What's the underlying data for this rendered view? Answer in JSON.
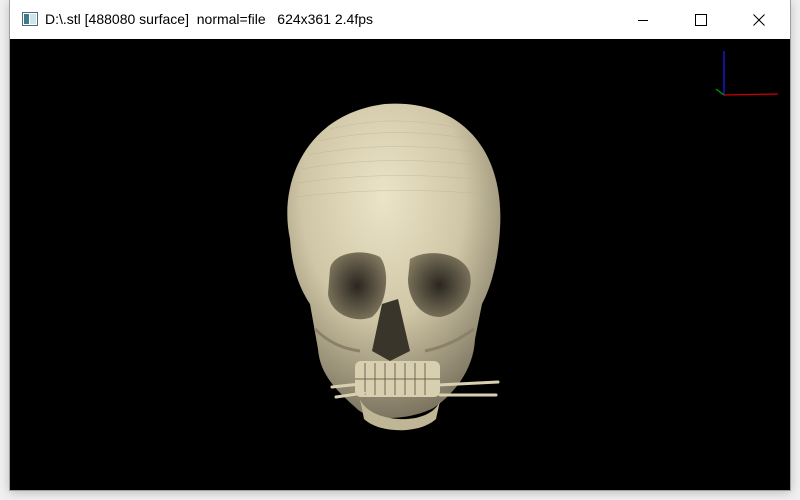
{
  "window": {
    "title": "D:\\.stl [488080 surface]  normal=file   624x361 2.4fps",
    "controls": {
      "minimize_icon": "minimize-icon",
      "maximize_icon": "maximize-icon",
      "close_icon": "close-icon"
    }
  },
  "viewport": {
    "background": "#000000",
    "model_color": "#d2c9a9",
    "axes": {
      "x_color": "#cc0000",
      "y_color": "#009900",
      "z_color": "#1a1aee"
    }
  }
}
